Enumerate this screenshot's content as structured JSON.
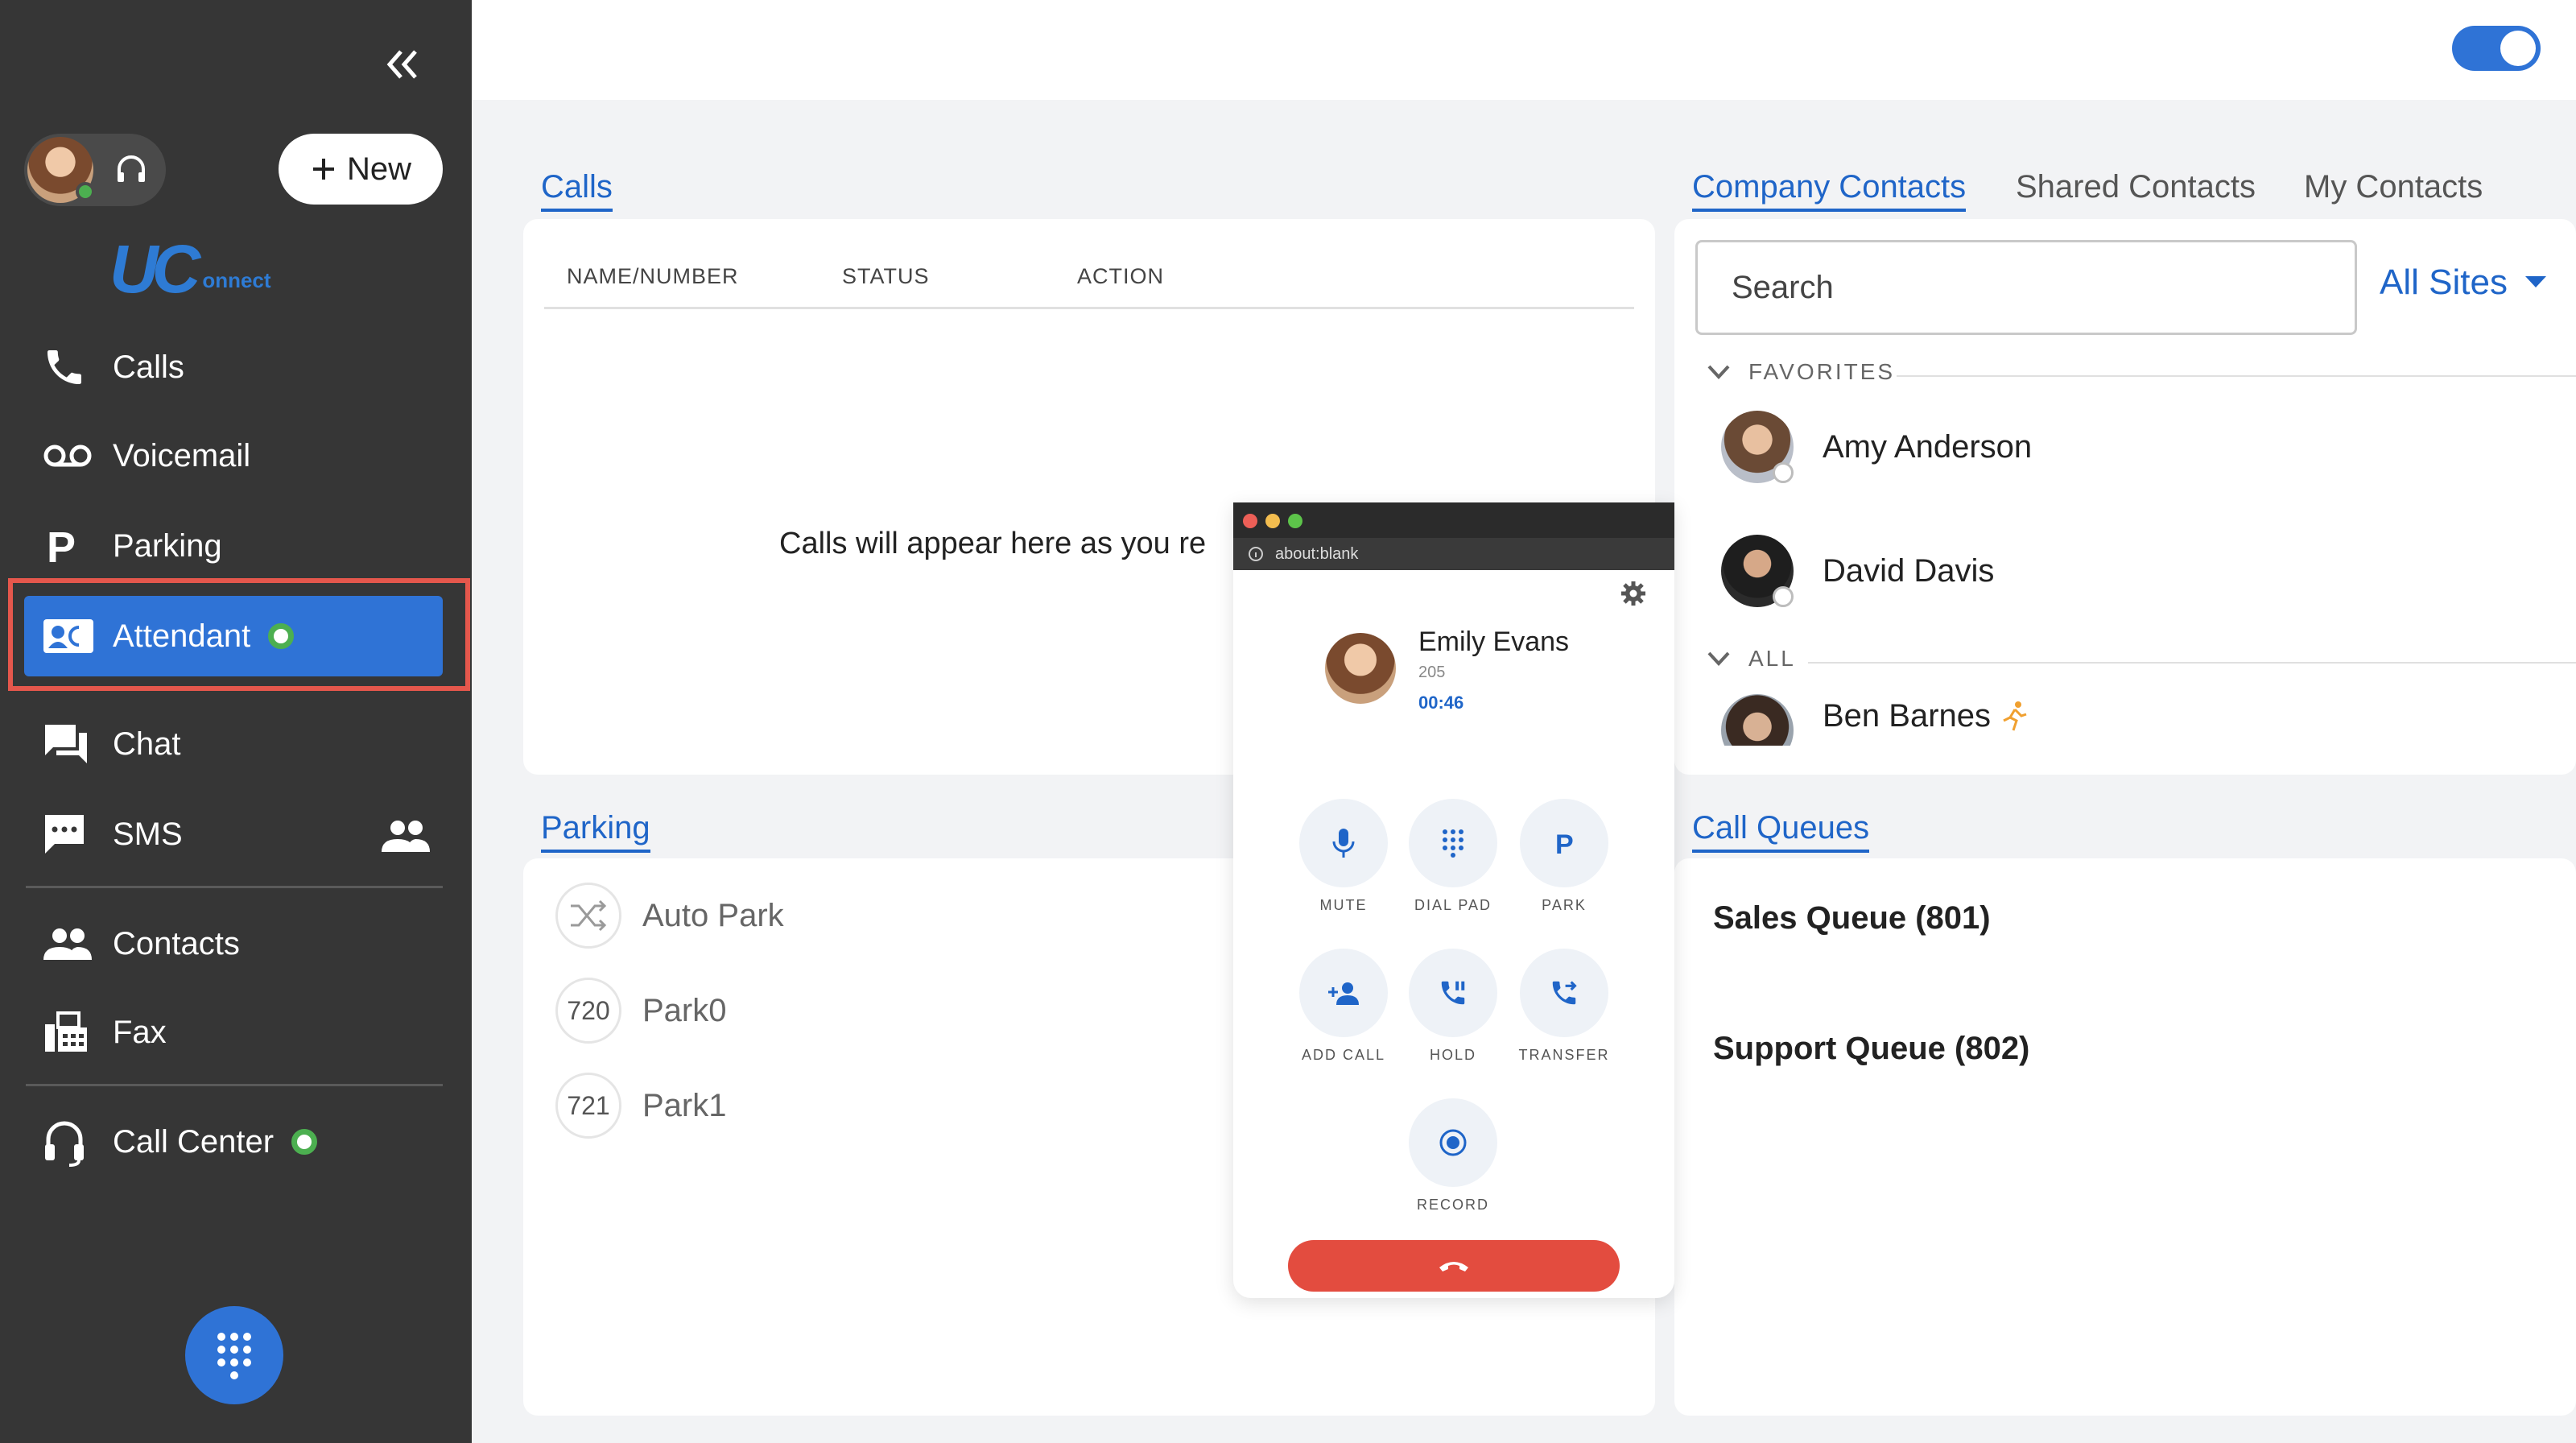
{
  "sidebar": {
    "new_button": "New",
    "logo_uc": "UC",
    "logo_suffix": "onnect",
    "nav": {
      "calls": "Calls",
      "voicemail": "Voicemail",
      "parking": "Parking",
      "attendant": "Attendant",
      "chat": "Chat",
      "sms": "SMS",
      "contacts": "Contacts",
      "fax": "Fax",
      "call_center": "Call Center"
    }
  },
  "calls": {
    "title": "Calls",
    "columns": [
      "NAME/NUMBER",
      "STATUS",
      "ACTION"
    ],
    "empty_message": "Calls will appear here as you re"
  },
  "parking": {
    "title": "Parking",
    "auto_park": "Auto Park",
    "slots": [
      {
        "number": "720",
        "name": "Park0"
      },
      {
        "number": "721",
        "name": "Park1"
      }
    ]
  },
  "contacts_panel": {
    "tabs": [
      "Company Contacts",
      "Shared Contacts",
      "My Contacts"
    ],
    "active_tab": "Company Contacts",
    "search_placeholder": "Search",
    "sites_select": "All Sites",
    "groups": {
      "favorites": "FAVORITES",
      "all": "ALL"
    },
    "favorites": [
      "Amy Anderson",
      "David Davis"
    ],
    "all": [
      "Ben Barnes"
    ]
  },
  "call_queues": {
    "title": "Call Queues",
    "items": [
      "Sales Queue (801)",
      "Support Queue (802)"
    ]
  },
  "call_popup": {
    "url": "about:blank",
    "caller_name": "Emily Evans",
    "caller_ext": "205",
    "duration": "00:46",
    "controls": {
      "mute": "MUTE",
      "dial_pad": "DIAL PAD",
      "park": "PARK",
      "add_call": "ADD CALL",
      "hold": "HOLD",
      "transfer": "TRANSFER",
      "record": "RECORD"
    }
  },
  "colors": {
    "accent": "#2f73d6",
    "sidebar_bg": "#363636",
    "online": "#4caf50",
    "hangup": "#e34c3f",
    "highlight_frame": "#e5574c"
  }
}
